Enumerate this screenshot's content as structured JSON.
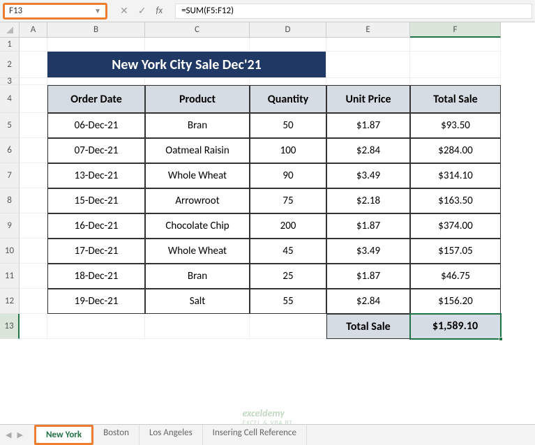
{
  "name_box": "F13",
  "formula": "=SUM(F5:F12)",
  "columns": [
    "A",
    "B",
    "C",
    "D",
    "E",
    "F"
  ],
  "col_widths": {
    "A": 40,
    "B": 140,
    "C": 150,
    "D": 110,
    "E": 120,
    "F": 130
  },
  "active_col": "F",
  "active_row": 13,
  "row_heights": {
    "1": 20,
    "2": 38,
    "3": 10,
    "4": 40,
    "5": 36,
    "6": 36,
    "7": 36,
    "8": 36,
    "9": 36,
    "10": 36,
    "11": 36,
    "12": 36,
    "13": 36
  },
  "title": "New York City Sale Dec'21",
  "headers": [
    "Order Date",
    "Product",
    "Quantity",
    "Unit Price",
    "Total Sale"
  ],
  "rows": [
    {
      "date": "06-Dec-21",
      "product": "Bran",
      "qty": "50",
      "price": "$1.87",
      "total": "$93.50"
    },
    {
      "date": "07-Dec-21",
      "product": "Oatmeal Raisin",
      "qty": "100",
      "price": "$2.84",
      "total": "$284.00"
    },
    {
      "date": "13-Dec-21",
      "product": "Whole Wheat",
      "qty": "90",
      "price": "$3.49",
      "total": "$314.10"
    },
    {
      "date": "15-Dec-21",
      "product": "Arrowroot",
      "qty": "75",
      "price": "$2.18",
      "total": "$163.50"
    },
    {
      "date": "16-Dec-21",
      "product": "Chocolate Chip",
      "qty": "200",
      "price": "$1.87",
      "total": "$374.00"
    },
    {
      "date": "17-Dec-21",
      "product": "Whole Wheat",
      "qty": "45",
      "price": "$3.49",
      "total": "$157.05"
    },
    {
      "date": "18-Dec-21",
      "product": "Bran",
      "qty": "25",
      "price": "$1.87",
      "total": "$46.75"
    },
    {
      "date": "19-Dec-21",
      "product": "Salt",
      "qty": "55",
      "price": "$2.84",
      "total": "$156.20"
    }
  ],
  "total_label": "Total Sale",
  "total_value": "$1,589.10",
  "tabs": [
    "New York",
    "Boston",
    "Los Angeles",
    "Insering Cell Reference"
  ],
  "active_tab": 0,
  "watermark": {
    "main": "exceldemy",
    "sub": "EXCEL & VBA BT"
  }
}
